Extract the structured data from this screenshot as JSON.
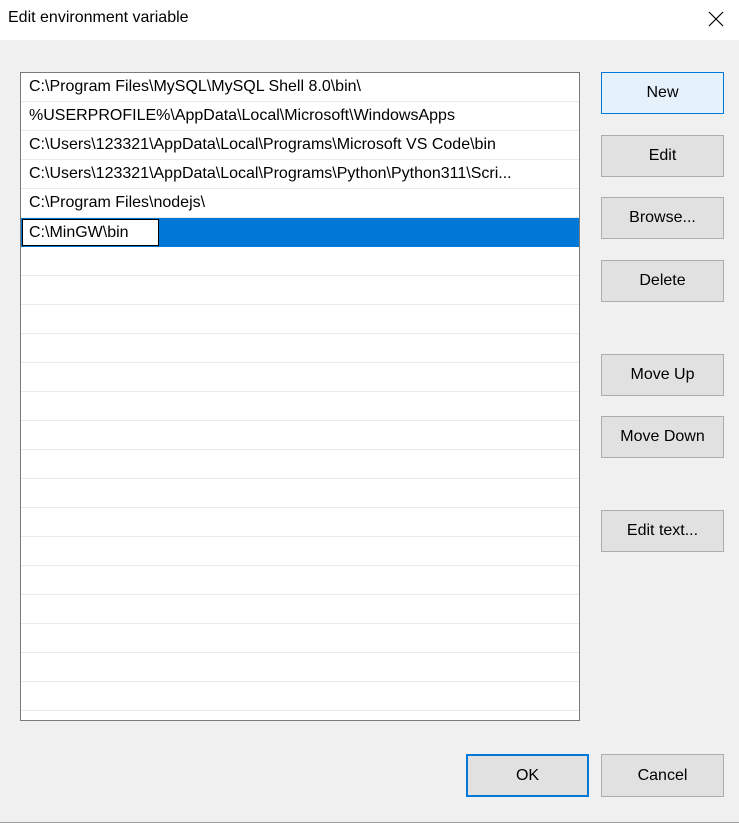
{
  "window": {
    "title": "Edit environment variable",
    "close_icon": "close-icon"
  },
  "list": {
    "items": [
      "C:\\Program Files\\MySQL\\MySQL Shell 8.0\\bin\\",
      "%USERPROFILE%\\AppData\\Local\\Microsoft\\WindowsApps",
      "C:\\Users\\123321\\AppData\\Local\\Programs\\Microsoft VS Code\\bin",
      "C:\\Users\\123321\\AppData\\Local\\Programs\\Python\\Python311\\Scri...",
      "C:\\Program Files\\nodejs\\"
    ],
    "editing_value": "C:\\MinGW\\bin",
    "selection_color": "#0078d7"
  },
  "buttons": {
    "new": "New",
    "edit": "Edit",
    "browse": "Browse...",
    "delete": "Delete",
    "move_up": "Move Up",
    "move_down": "Move Down",
    "edit_text": "Edit text...",
    "ok": "OK",
    "cancel": "Cancel"
  }
}
